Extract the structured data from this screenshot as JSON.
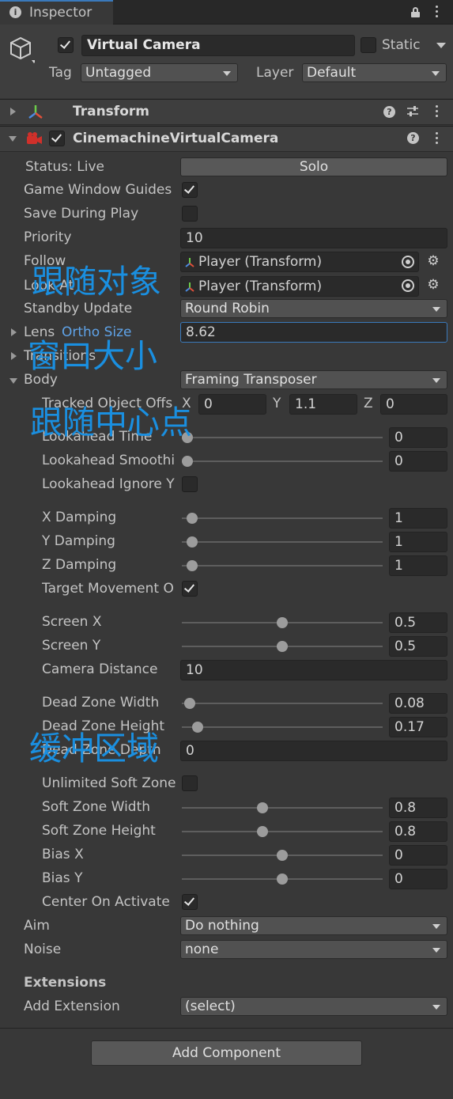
{
  "tab": {
    "title": "Inspector"
  },
  "gameobject": {
    "name": "Virtual Camera",
    "static_label": "Static",
    "tag_label": "Tag",
    "tag_value": "Untagged",
    "layer_label": "Layer",
    "layer_value": "Default"
  },
  "transform": {
    "title": "Transform"
  },
  "vcam": {
    "title": "CinemachineVirtualCamera",
    "status": "Status: Live",
    "solo": "Solo",
    "game_window_guides": "Game Window Guides",
    "save_during_play": "Save During Play",
    "priority_label": "Priority",
    "priority_value": "10",
    "follow_label": "Follow",
    "follow_value": "Player (Transform)",
    "lookat_label": "Look At",
    "lookat_value": "Player (Transform)",
    "standby_label": "Standby Update",
    "standby_value": "Round Robin",
    "lens_label": "Lens",
    "lens_sub": "Ortho Size",
    "lens_value": "8.62",
    "transitions_label": "Transitions",
    "body_label": "Body",
    "body_value": "Framing Transposer"
  },
  "body": {
    "tracked_offset_label": "Tracked Object Offs",
    "x_label": "X",
    "x_value": "0",
    "y_label": "Y",
    "y_value": "1.1",
    "z_label": "Z",
    "z_value": "0",
    "lookahead_time": {
      "label": "Lookahead Time",
      "value": "0",
      "level": 0.0
    },
    "lookahead_smoothing": {
      "label": "Lookahead Smoothi",
      "value": "0",
      "level": 0.0
    },
    "lookahead_ignore_y": "Lookahead Ignore Y",
    "x_damping": {
      "label": "X Damping",
      "value": "1",
      "level": 0.05
    },
    "y_damping": {
      "label": "Y Damping",
      "value": "1",
      "level": 0.05
    },
    "z_damping": {
      "label": "Z Damping",
      "value": "1",
      "level": 0.05
    },
    "target_movement": "Target Movement O",
    "screen_x": {
      "label": "Screen X",
      "value": "0.5",
      "level": 0.5
    },
    "screen_y": {
      "label": "Screen Y",
      "value": "0.5",
      "level": 0.5
    },
    "camera_distance_label": "Camera Distance",
    "camera_distance_value": "10",
    "dead_zone_width": {
      "label": "Dead Zone Width",
      "value": "0.08",
      "level": 0.04
    },
    "dead_zone_height": {
      "label": "Dead Zone Height",
      "value": "0.17",
      "level": 0.08
    },
    "dead_zone_depth_label": "Dead Zone Depth",
    "dead_zone_depth_value": "0",
    "unlimited_soft_zone": "Unlimited Soft Zone",
    "soft_zone_width": {
      "label": "Soft Zone Width",
      "value": "0.8",
      "level": 0.4
    },
    "soft_zone_height": {
      "label": "Soft Zone Height",
      "value": "0.8",
      "level": 0.4
    },
    "bias_x": {
      "label": "Bias X",
      "value": "0",
      "level": 0.5
    },
    "bias_y": {
      "label": "Bias Y",
      "value": "0",
      "level": 0.5
    },
    "center_on_activate": "Center On Activate"
  },
  "aim": {
    "label": "Aim",
    "value": "Do nothing"
  },
  "noise": {
    "label": "Noise",
    "value": "none"
  },
  "extensions": {
    "title": "Extensions",
    "add_label": "Add Extension",
    "add_value": "(select)"
  },
  "add_component": "Add Component",
  "annotations": {
    "follow_target": "跟随对象",
    "window_size": "窗口大小",
    "follow_center": "跟随中心点",
    "buffer_zone": "缓冲区域"
  },
  "colors": {
    "panel_bg": "#383838",
    "annotation": "#1a8fe0",
    "field_focus": "#3a79bb"
  }
}
